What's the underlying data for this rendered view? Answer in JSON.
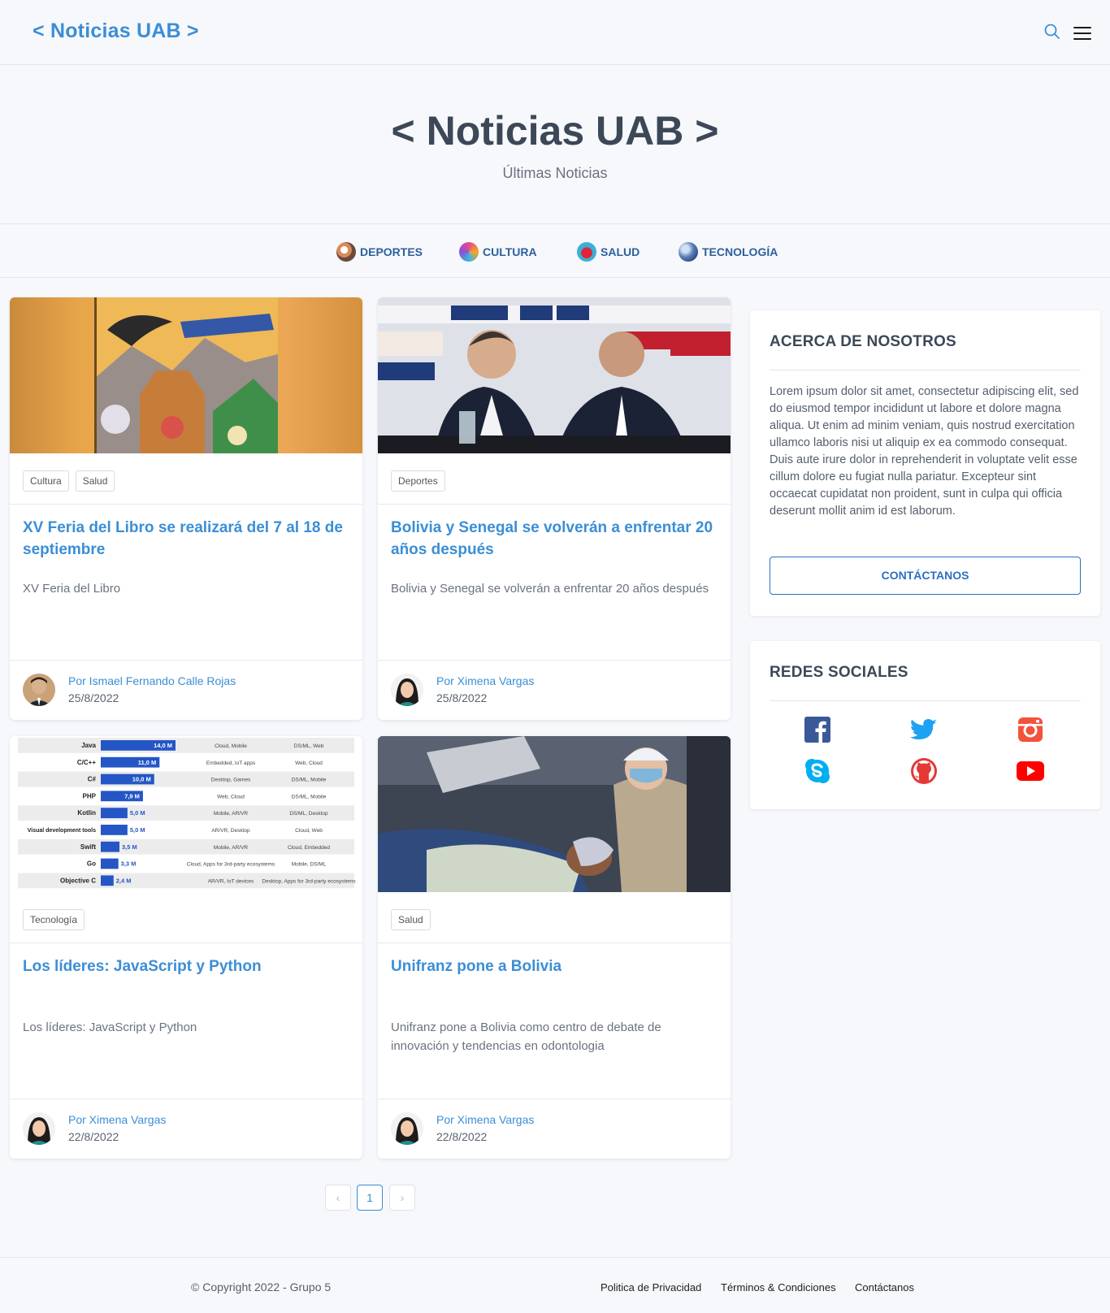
{
  "nav": {
    "brand": "< Noticias UAB >"
  },
  "hero": {
    "title": "< Noticias UAB >",
    "subtitle": "Últimas Noticias"
  },
  "categories": [
    {
      "label": "DEPORTES",
      "icon": "soccer-ball-icon"
    },
    {
      "label": "CULTURA",
      "icon": "culture-icon"
    },
    {
      "label": "SALUD",
      "icon": "heart-icon"
    },
    {
      "label": "TECNOLOGÍA",
      "icon": "globe-tech-icon"
    }
  ],
  "cards": [
    {
      "tags": [
        "Cultura",
        "Salud"
      ],
      "title": "XV Feria del Libro se realizará del 7 al 18 de septiembre",
      "desc": "XV Feria del Libro",
      "author": "Por Ismael Fernando Calle Rojas",
      "date": "25/8/2022"
    },
    {
      "tags": [
        "Deportes"
      ],
      "title": "Bolivia y Senegal se volverán a enfrentar 20 años después",
      "desc": "Bolivia y Senegal se volverán a enfrentar 20 años después",
      "author": "Por Ximena Vargas",
      "date": "25/8/2022"
    },
    {
      "tags": [
        "Tecnología"
      ],
      "title": "Los líderes: JavaScript y Python",
      "desc": "Los líderes: JavaScript y Python",
      "author": "Por Ximena Vargas",
      "date": "22/8/2022"
    },
    {
      "tags": [
        "Salud"
      ],
      "title": "Unifranz pone a Bolivia",
      "desc": "Unifranz pone a Bolivia como centro de debate de innovación y tendencias en odontologia",
      "author": "Por Ximena Vargas",
      "date": "22/8/2022"
    }
  ],
  "lang_chart": {
    "rows": [
      {
        "lang": "Java",
        "value": "14,0 M",
        "v": 14.0,
        "c1": "Cloud, Mobile",
        "c2": "DS/ML, Web"
      },
      {
        "lang": "C/C++",
        "value": "11,0 M",
        "v": 11.0,
        "c1": "Embedded, IoT apps",
        "c2": "Web, Cloud"
      },
      {
        "lang": "C#",
        "value": "10,0 M",
        "v": 10.0,
        "c1": "Desktop, Games",
        "c2": "DS/ML, Mobile"
      },
      {
        "lang": "PHP",
        "value": "7,9 M",
        "v": 7.9,
        "c1": "Web, Cloud",
        "c2": "DS/ML, Mobile"
      },
      {
        "lang": "Kotlin",
        "value": "5,0 M",
        "v": 5.0,
        "c1": "Mobile, AR/VR",
        "c2": "DS/ML, Desktop"
      },
      {
        "lang": "Visual development tools",
        "value": "5,0 M",
        "v": 5.0,
        "c1": "AR/VR, Desktop",
        "c2": "Cloud, Web"
      },
      {
        "lang": "Swift",
        "value": "3,5 M",
        "v": 3.5,
        "c1": "Mobile, AR/VR",
        "c2": "Cloud, Embedded"
      },
      {
        "lang": "Go",
        "value": "3,3 M",
        "v": 3.3,
        "c1": "Cloud, Apps for 3rd-party ecosystems",
        "c2": "Mobile, DS/ML"
      },
      {
        "lang": "Objective C",
        "value": "2,4 M",
        "v": 2.4,
        "c1": "AR/VR, IoT devices",
        "c2": "Desktop, Apps for 3rd-party ecosystems"
      }
    ]
  },
  "about": {
    "title": "ACERCA DE NOSOTROS",
    "text": "Lorem ipsum dolor sit amet, consectetur adipiscing elit, sed do eiusmod tempor incididunt ut labore et dolore magna aliqua. Ut enim ad minim veniam, quis nostrud exercitation ullamco laboris nisi ut aliquip ex ea commodo consequat. Duis aute irure dolor in reprehenderit in voluptate velit esse cillum dolore eu fugiat nulla pariatur. Excepteur sint occaecat cupidatat non proident, sunt in culpa qui officia deserunt mollit anim id est laborum.",
    "button": "CONTÁCTANOS"
  },
  "social": {
    "title": "REDES SOCIALES",
    "icons": [
      "facebook-icon",
      "twitter-icon",
      "instagram-icon",
      "skype-icon",
      "github-icon",
      "youtube-icon"
    ],
    "colors": {
      "facebook": "#3b5998",
      "twitter": "#1da1f2",
      "instagram": "#f4523b",
      "skype": "#00aff0",
      "github": "#e53935",
      "youtube": "#ff0000"
    }
  },
  "pagination": {
    "prev": "‹",
    "current": "1",
    "next": "›"
  },
  "footer": {
    "copyright": "© Copyright 2022 - Grupo 5",
    "links": [
      "Politica de Privacidad",
      "Términos & Condiciones",
      "Contáctanos"
    ]
  },
  "colors": {
    "accent": "#3b8ed6",
    "heading": "#3c4858",
    "button": "#2c6fc2"
  }
}
